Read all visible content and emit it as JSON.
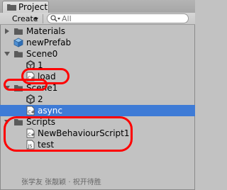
{
  "window": {
    "tab_label": "Project"
  },
  "toolbar": {
    "create_label": "Create",
    "search_placeholder": "All"
  },
  "tree": [
    {
      "id": "materials",
      "label": "Materials",
      "type": "folder",
      "expanded": false
    },
    {
      "id": "newprefab",
      "label": "newPrefab",
      "type": "prefab"
    },
    {
      "id": "scene0",
      "label": "Scene0",
      "type": "folder",
      "expanded": true
    },
    {
      "id": "scene0-1",
      "label": "1",
      "type": "unity-scene"
    },
    {
      "id": "load",
      "label": "load",
      "type": "csharp-script"
    },
    {
      "id": "scene1",
      "label": "Scene1",
      "type": "folder",
      "expanded": true
    },
    {
      "id": "scene1-2",
      "label": "2",
      "type": "unity-scene"
    },
    {
      "id": "async",
      "label": "async",
      "type": "csharp-script",
      "selected": true
    },
    {
      "id": "scripts",
      "label": "Scripts",
      "type": "folder",
      "expanded": true
    },
    {
      "id": "newbehaviour",
      "label": "NewBehaviourScript1",
      "type": "csharp-script"
    },
    {
      "id": "test",
      "label": "test",
      "type": "javascript"
    }
  ],
  "colors": {
    "selection": "#3e7bd6",
    "annotation": "#ff0000"
  },
  "watermark": "张学友 张靓颖 · 祝开待胜"
}
